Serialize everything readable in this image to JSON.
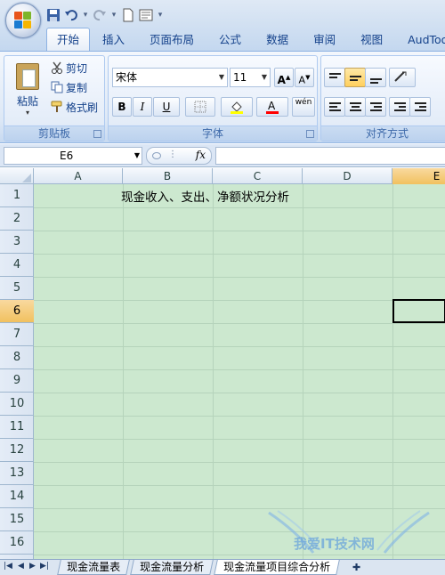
{
  "quick_access": {
    "items": [
      "save-icon",
      "undo-icon",
      "redo-icon",
      "new-document-icon",
      "print-preview-icon"
    ],
    "customize_glyph": "▾"
  },
  "ribbon_tabs": [
    {
      "label": "开始",
      "active": true
    },
    {
      "label": "插入"
    },
    {
      "label": "页面布局"
    },
    {
      "label": "公式"
    },
    {
      "label": "数据"
    },
    {
      "label": "审阅"
    },
    {
      "label": "视图"
    },
    {
      "label": "AudToo"
    }
  ],
  "clipboard": {
    "paste_label": "粘贴",
    "cut_label": "剪切",
    "copy_label": "复制",
    "format_painter_label": "格式刷",
    "group_label": "剪贴板"
  },
  "font": {
    "font_name": "宋体",
    "font_size": "11",
    "grow_label": "A",
    "shrink_label": "A",
    "bold_label": "B",
    "italic_label": "I",
    "underline_label": "U",
    "phonetic_label": "wén",
    "group_label": "字体",
    "fill_color": "#ffff00",
    "font_color": "#ff0000"
  },
  "alignment": {
    "group_label": "对齐方式"
  },
  "formula_bar": {
    "name_box": "E6",
    "fx_label": "fx",
    "formula": ""
  },
  "sheet": {
    "columns": [
      "A",
      "B",
      "C",
      "D",
      "E"
    ],
    "selected_column": "E",
    "rows": [
      "1",
      "2",
      "3",
      "4",
      "5",
      "6",
      "7",
      "8",
      "9",
      "10",
      "11",
      "12",
      "13",
      "14",
      "15",
      "16"
    ],
    "selected_row": "6",
    "cells": {
      "B1": "现金收入、支出、净额状况分析"
    },
    "selected_cell": "E6",
    "background_color": "#cce8cf"
  },
  "sheet_tabs": [
    {
      "label": "现金流量表"
    },
    {
      "label": "现金流量分析"
    },
    {
      "label": "现金流量项目综合分析",
      "active": true
    }
  ],
  "watermark": {
    "text": "我爱IT技术网"
  }
}
